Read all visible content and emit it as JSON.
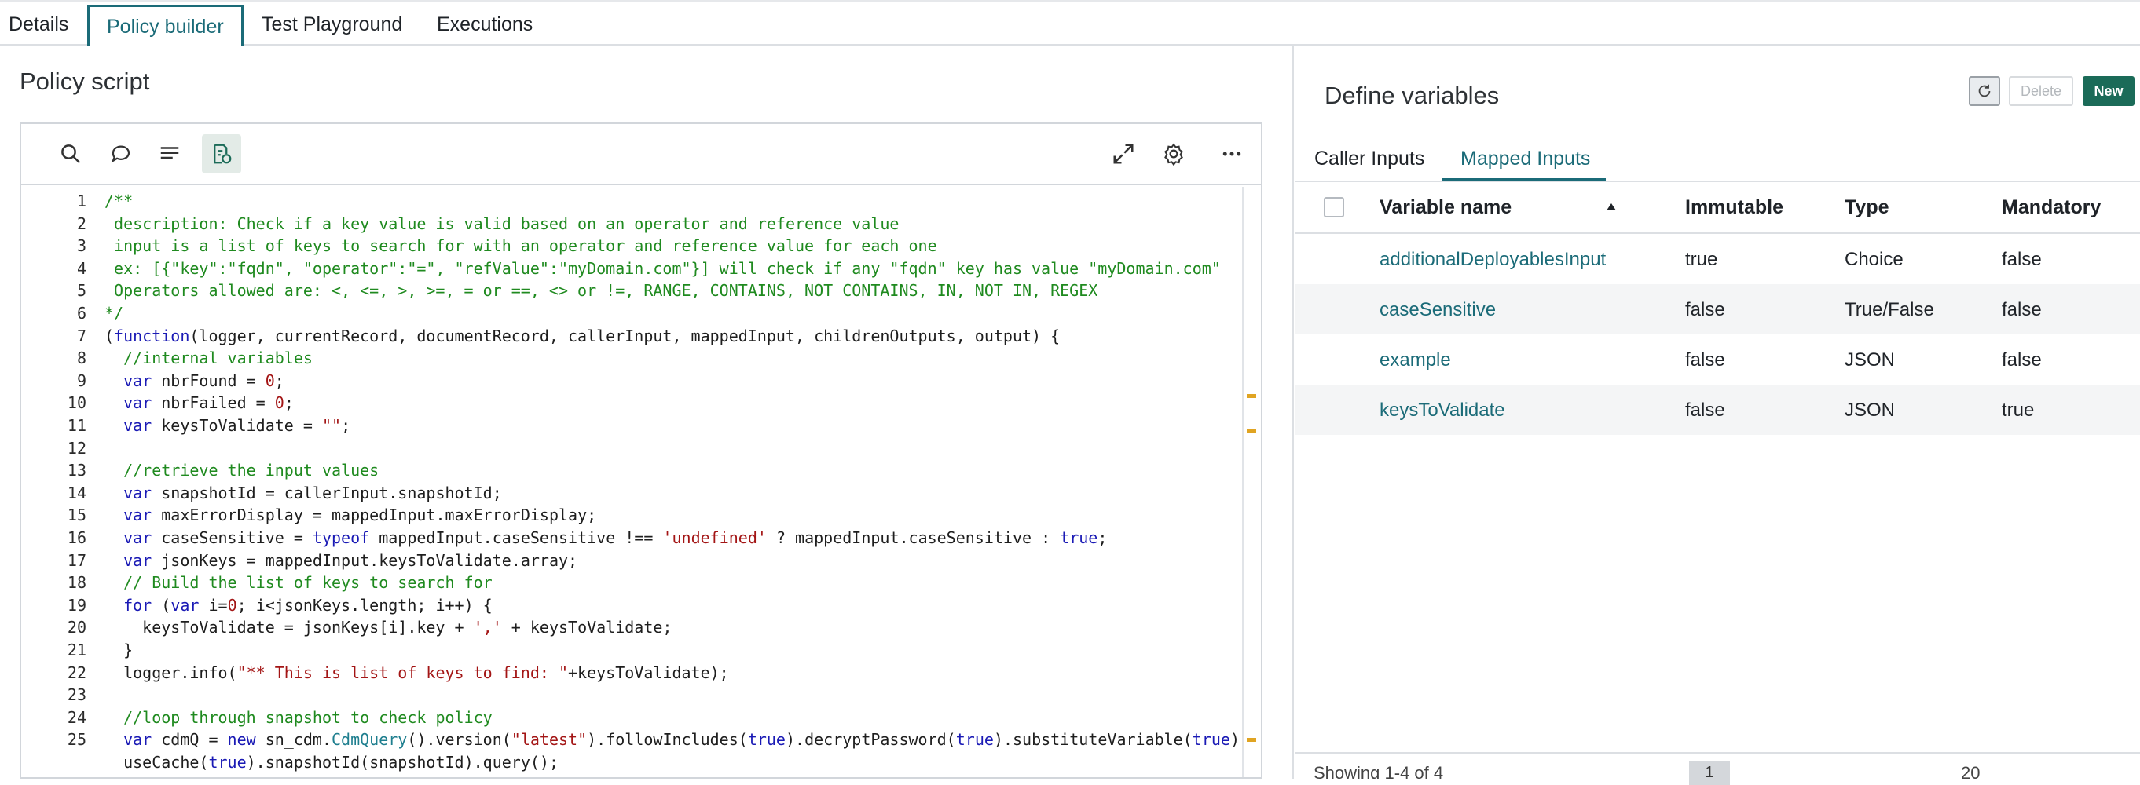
{
  "tabs": [
    {
      "label": "Details"
    },
    {
      "label": "Policy builder"
    },
    {
      "label": "Test Playground"
    },
    {
      "label": "Executions"
    }
  ],
  "left": {
    "title": "Policy script",
    "toolbar_icons": [
      "search-icon",
      "comment-icon",
      "format-icon",
      "script-debug-icon",
      "expand-icon",
      "settings-icon",
      "more-icon"
    ]
  },
  "code": {
    "line_numbers": [
      "1",
      "2",
      "3",
      "4",
      "5",
      "6",
      "7",
      "8",
      "9",
      "10",
      "11",
      "12",
      "13",
      "14",
      "15",
      "16",
      "17",
      "18",
      "19",
      "20",
      "21",
      "22",
      "23",
      "24",
      "25"
    ],
    "lines": [
      [
        {
          "t": "/**",
          "c": "c"
        }
      ],
      [
        {
          "t": " description: Check if a key value is valid based on an operator and reference value",
          "c": "c"
        }
      ],
      [
        {
          "t": " input is a list of keys to search for with an operator and reference value for each one",
          "c": "c"
        }
      ],
      [
        {
          "t": " ex: [{\"key\":\"fqdn\", \"operator\":\"=\", \"refValue\":\"myDomain.com\"}] will check if any \"fqdn\" key has value \"myDomain.com\"",
          "c": "c"
        }
      ],
      [
        {
          "t": " Operators allowed are: <, <=, >, >=, = or ==, <> or !=, RANGE, CONTAINS, NOT CONTAINS, IN, NOT IN, REGEX",
          "c": "c"
        }
      ],
      [
        {
          "t": "*/",
          "c": "c"
        }
      ],
      [
        {
          "t": "(",
          "c": ""
        },
        {
          "t": "function",
          "c": "k"
        },
        {
          "t": "(logger, currentRecord, documentRecord, callerInput, mappedInput, childrenOutputs, output) {",
          "c": ""
        }
      ],
      [
        {
          "t": "  ",
          "c": ""
        },
        {
          "t": "//internal variables",
          "c": "c"
        }
      ],
      [
        {
          "t": "  ",
          "c": ""
        },
        {
          "t": "var",
          "c": "k"
        },
        {
          "t": " nbrFound = ",
          "c": ""
        },
        {
          "t": "0",
          "c": "s"
        },
        {
          "t": ";",
          "c": ""
        }
      ],
      [
        {
          "t": "  ",
          "c": ""
        },
        {
          "t": "var",
          "c": "k"
        },
        {
          "t": " nbrFailed = ",
          "c": ""
        },
        {
          "t": "0",
          "c": "s"
        },
        {
          "t": ";",
          "c": ""
        }
      ],
      [
        {
          "t": "  ",
          "c": ""
        },
        {
          "t": "var",
          "c": "k"
        },
        {
          "t": " keysToValidate = ",
          "c": ""
        },
        {
          "t": "\"\"",
          "c": "s"
        },
        {
          "t": ";",
          "c": ""
        }
      ],
      [
        {
          "t": "",
          "c": ""
        }
      ],
      [
        {
          "t": "  ",
          "c": ""
        },
        {
          "t": "//retrieve the input values",
          "c": "c"
        }
      ],
      [
        {
          "t": "  ",
          "c": ""
        },
        {
          "t": "var",
          "c": "k"
        },
        {
          "t": " snapshotId = callerInput.snapshotId;",
          "c": ""
        }
      ],
      [
        {
          "t": "  ",
          "c": ""
        },
        {
          "t": "var",
          "c": "k"
        },
        {
          "t": " maxErrorDisplay = mappedInput.maxErrorDisplay;",
          "c": ""
        }
      ],
      [
        {
          "t": "  ",
          "c": ""
        },
        {
          "t": "var",
          "c": "k"
        },
        {
          "t": " caseSensitive = ",
          "c": ""
        },
        {
          "t": "typeof",
          "c": "k"
        },
        {
          "t": " mappedInput.caseSensitive !== ",
          "c": ""
        },
        {
          "t": "'undefined'",
          "c": "s"
        },
        {
          "t": " ? mappedInput.caseSensitive : ",
          "c": ""
        },
        {
          "t": "true",
          "c": "k"
        },
        {
          "t": ";",
          "c": ""
        }
      ],
      [
        {
          "t": "  ",
          "c": ""
        },
        {
          "t": "var",
          "c": "k"
        },
        {
          "t": " jsonKeys = mappedInput.keysToValidate.array;",
          "c": ""
        }
      ],
      [
        {
          "t": "  ",
          "c": ""
        },
        {
          "t": "// Build the list of keys to search for",
          "c": "c"
        }
      ],
      [
        {
          "t": "  ",
          "c": ""
        },
        {
          "t": "for",
          "c": "k"
        },
        {
          "t": " (",
          "c": ""
        },
        {
          "t": "var",
          "c": "k"
        },
        {
          "t": " i=",
          "c": ""
        },
        {
          "t": "0",
          "c": "s"
        },
        {
          "t": "; i<jsonKeys.length; i++) {",
          "c": ""
        }
      ],
      [
        {
          "t": "    keysToValidate = jsonKeys[i].key + ",
          "c": ""
        },
        {
          "t": "','",
          "c": "s"
        },
        {
          "t": " + keysToValidate;",
          "c": ""
        }
      ],
      [
        {
          "t": "  }",
          "c": ""
        }
      ],
      [
        {
          "t": "  logger.info(",
          "c": ""
        },
        {
          "t": "\"** This is list of keys to find: \"",
          "c": "s"
        },
        {
          "t": "+keysToValidate);",
          "c": ""
        }
      ],
      [
        {
          "t": "",
          "c": ""
        }
      ],
      [
        {
          "t": "  ",
          "c": ""
        },
        {
          "t": "//loop through snapshot to check policy",
          "c": "c"
        }
      ],
      [
        {
          "t": "  ",
          "c": ""
        },
        {
          "t": "var",
          "c": "k"
        },
        {
          "t": " cdmQ = ",
          "c": ""
        },
        {
          "t": "new",
          "c": "k"
        },
        {
          "t": " sn_cdm.",
          "c": ""
        },
        {
          "t": "CdmQuery",
          "c": "t"
        },
        {
          "t": "().version(",
          "c": ""
        },
        {
          "t": "\"latest\"",
          "c": "s"
        },
        {
          "t": ").followIncludes(",
          "c": ""
        },
        {
          "t": "true",
          "c": "k"
        },
        {
          "t": ").decryptPassword(",
          "c": ""
        },
        {
          "t": "true",
          "c": "k"
        },
        {
          "t": ").substituteVariable(",
          "c": ""
        },
        {
          "t": "true",
          "c": "k"
        },
        {
          "t": ").",
          "c": ""
        }
      ],
      [
        {
          "t": "  useCache(",
          "c": ""
        },
        {
          "t": "true",
          "c": "k"
        },
        {
          "t": ").snapshotId(snapshotId).query();",
          "c": ""
        }
      ]
    ]
  },
  "right": {
    "title": "Define variables",
    "delete_label": "Delete",
    "new_label": "New",
    "tabs": [
      {
        "label": "Caller Inputs"
      },
      {
        "label": "Mapped Inputs"
      }
    ],
    "columns": [
      "Variable name",
      "Immutable",
      "Type",
      "Mandatory"
    ],
    "rows": [
      {
        "name": "additionalDeployablesInput",
        "immutable": "true",
        "type": "Choice",
        "mandatory": "false"
      },
      {
        "name": "caseSensitive",
        "immutable": "false",
        "type": "True/False",
        "mandatory": "false"
      },
      {
        "name": "example",
        "immutable": "false",
        "type": "JSON",
        "mandatory": "false"
      },
      {
        "name": "keysToValidate",
        "immutable": "false",
        "type": "JSON",
        "mandatory": "true"
      }
    ],
    "footer_text": "Showing 1-4 of 4",
    "footer_page": "1",
    "footer_per_page": "20"
  },
  "colors": {
    "accent": "#1b6b78",
    "primary_button": "#1b6b58",
    "comment": "#1f8a1f",
    "keyword": "#1a1ab5",
    "string": "#a31515"
  }
}
